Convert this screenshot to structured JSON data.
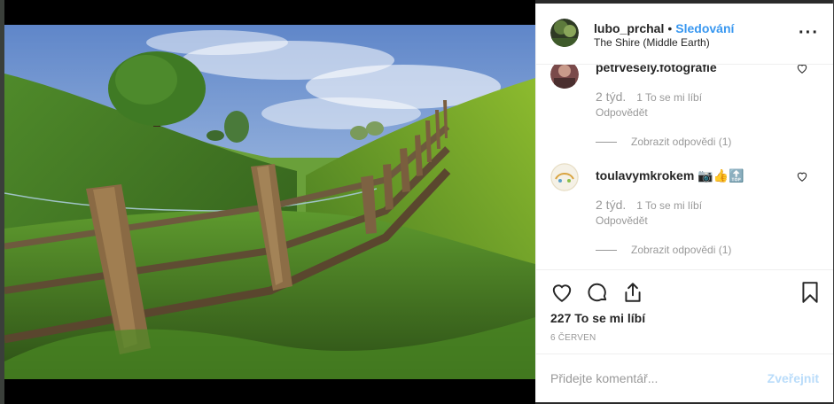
{
  "post": {
    "username": "lubo_prchal",
    "separator": "•",
    "follow_label": "Sledování",
    "location": "The Shire (Middle Earth)",
    "more_icon": "more-horizontal-icon"
  },
  "comments": [
    {
      "username": "petrvesely.fotografie",
      "emojis": "",
      "age": "2 týd.",
      "likes": "1 To se mi líbí",
      "reply_label": "Odpovědět",
      "view_replies": "Zobrazit odpovědi (1)"
    },
    {
      "username": "toulavymkrokem",
      "emojis": "📷👍🔝",
      "age": "2 týd.",
      "likes": "1 To se mi líbí",
      "reply_label": "Odpovědět",
      "view_replies": "Zobrazit odpovědi (1)"
    }
  ],
  "actions": {
    "like_icon": "heart-icon",
    "comment_icon": "comment-icon",
    "share_icon": "share-icon",
    "save_icon": "bookmark-icon",
    "likes_count": "227 To se mi líbí",
    "date": "6 ČERVEN"
  },
  "add_comment": {
    "placeholder": "Přidejte komentář...",
    "post_label": "Zveřejnit"
  },
  "colors": {
    "link": "#3897f0",
    "post_disabled": "#b9dcfa",
    "text": "#262626",
    "muted": "#999999"
  }
}
